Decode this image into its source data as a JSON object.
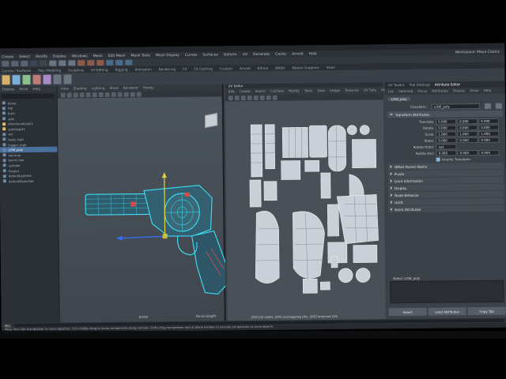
{
  "app": {
    "title": "Autodesk Maya",
    "menus": [
      "Create",
      "Select",
      "Modify",
      "Display",
      "Windows",
      "Mesh",
      "Edit Mesh",
      "Mesh Tools",
      "Mesh Display",
      "Curves",
      "Surfaces",
      "Deform",
      "UV",
      "Generate",
      "Cache",
      "Arnold",
      "Help"
    ],
    "workspace_label": "Workspace: Maya Classic"
  },
  "shelf": {
    "tabs": [
      "Curves / Surfaces",
      "Poly Modeling",
      "Sculpting",
      "UV Editing",
      "Rigging",
      "Animation",
      "Rendering",
      "FX",
      "FX Caching",
      "Custom",
      "Arnold",
      "Bifrost",
      "MASH",
      "Motion Graphics",
      "XGen"
    ]
  },
  "outliner": {
    "menus": [
      "Display",
      "Show",
      "Help"
    ],
    "items": [
      "persp",
      "top",
      "front",
      "side",
      "directionalLight1",
      "pointLight1",
      "set",
      "body_high",
      "trigger_high",
      "LOW_poly",
      "hammer",
      "barrel_low",
      "cylinder",
      "Origin1",
      "defaultLightSet",
      "defaultObjectSet"
    ],
    "selected_index": 9
  },
  "viewport": {
    "menus": [
      "View",
      "Shading",
      "Lighting",
      "Show",
      "Renderer",
      "Panels"
    ],
    "camera_label": "persp",
    "focal_label": "Focal Length"
  },
  "uv_editor": {
    "title": "UV Editor",
    "menus": [
      "Edit",
      "Create",
      "Select",
      "Cut/Sew",
      "Modify",
      "Tools",
      "View",
      "Image",
      "Textures",
      "UV Sets",
      "Help"
    ],
    "status": "[0/0] UV shells, [0/0] overlapping UVs, [0/0] reversed UVs"
  },
  "attribute_editor": {
    "tabs": [
      "UV Toolkit",
      "Tool Settings",
      "Attribute Editor"
    ],
    "menus": [
      "List",
      "Selected",
      "Focus",
      "Attributes",
      "Display",
      "Show",
      "Help"
    ],
    "node_tab": "LOW_poly",
    "transform_label": "transform:",
    "transform_value": "LOW_poly",
    "section_open": "Transform Attributes",
    "rows": [
      {
        "label": "Translate",
        "values": [
          "0.000",
          "0.000",
          "0.000"
        ]
      },
      {
        "label": "Rotate",
        "values": [
          "0.000",
          "0.000",
          "0.000"
        ]
      },
      {
        "label": "Scale",
        "values": [
          "1.000",
          "1.000",
          "1.000"
        ]
      },
      {
        "label": "Shear",
        "values": [
          "0.000",
          "0.000",
          "0.000"
        ]
      },
      {
        "label": "Rotate Order",
        "values": [
          "xyz"
        ]
      },
      {
        "label": "Rotate Axis",
        "values": [
          "0.000",
          "0.000",
          "0.000"
        ]
      }
    ],
    "inherits_label": "Inherits Transform",
    "collapsed_sections": [
      "Pivots",
      "Limit Information",
      "Display",
      "Node Behavior",
      "UUID",
      "Extra Attributes"
    ],
    "offset_section": "Offset Parent Matrix",
    "notes_label": "Notes: LOW_poly",
    "buttons": [
      "Select",
      "Load Attributes",
      "Copy Tab"
    ]
  },
  "bottom": {
    "cmd_label": "MEL",
    "help_text": "Move Tool: Use manipulator to move object(s). Ctrl+middle-drag to move components along normals. Shift+drag manipulator axis or plane handles to extrude components or clone objects."
  }
}
